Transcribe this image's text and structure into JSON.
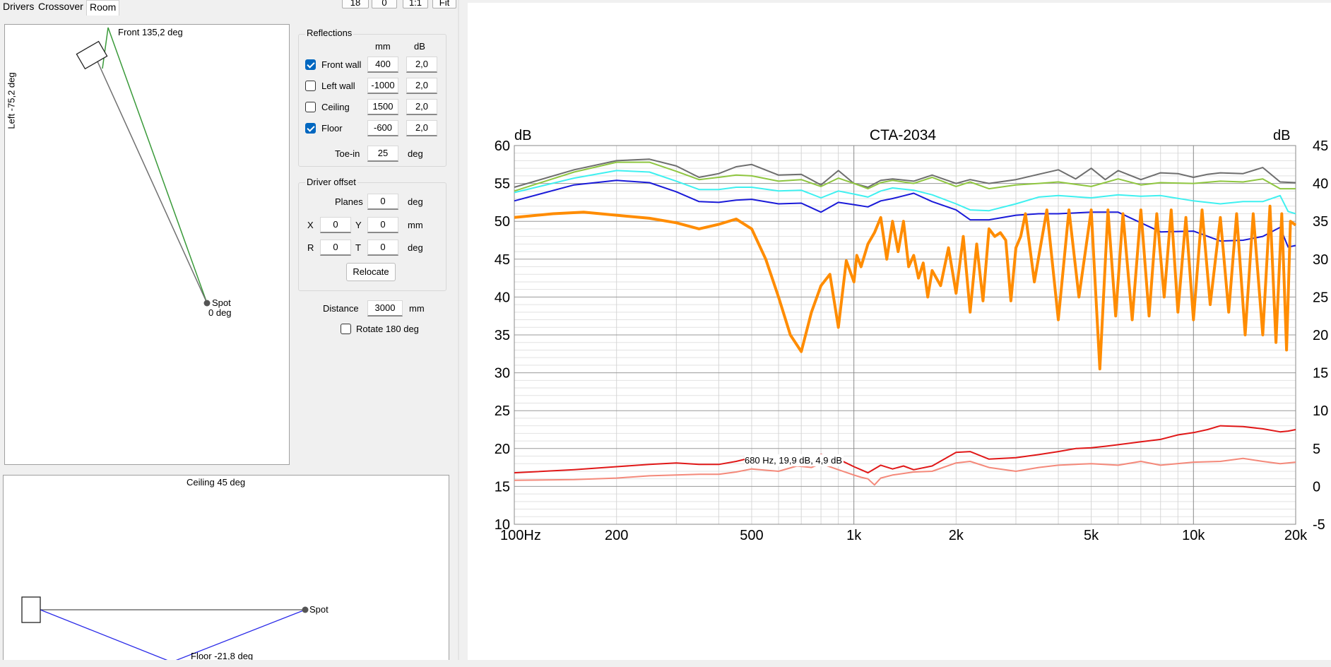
{
  "tabs": [
    {
      "label": "Drivers",
      "active": false
    },
    {
      "label": "Crossover",
      "active": false
    },
    {
      "label": "Room",
      "active": true
    }
  ],
  "toolbar": {
    "b1": "18",
    "b2": "0",
    "b3": "1:1",
    "b4": "Fit"
  },
  "top_view": {
    "front_label": "Front 135,2 deg",
    "left_label": "Left -75,2 deg",
    "spot_label": "Spot",
    "spot_deg": "0 deg"
  },
  "side_view": {
    "ceiling_label": "Ceiling 45 deg",
    "floor_label": "Floor -21,8 deg",
    "spot_label": "Spot"
  },
  "reflections": {
    "title": "Reflections",
    "col_mm": "mm",
    "col_db": "dB",
    "rows": [
      {
        "label": "Front wall",
        "checked": true,
        "mm": "400",
        "db": "2,0"
      },
      {
        "label": "Left wall",
        "checked": false,
        "mm": "-1000",
        "db": "2,0"
      },
      {
        "label": "Ceiling",
        "checked": false,
        "mm": "1500",
        "db": "2,0"
      },
      {
        "label": "Floor",
        "checked": true,
        "mm": "-600",
        "db": "2,0"
      }
    ],
    "toein_label": "Toe-in",
    "toein_value": "25",
    "toein_unit": "deg"
  },
  "driver_offset": {
    "title": "Driver offset",
    "planes_label": "Planes",
    "planes_value": "0",
    "planes_unit": "deg",
    "x_label": "X",
    "x_value": "0",
    "y_label": "Y",
    "y_value": "0",
    "xy_unit": "mm",
    "r_label": "R",
    "r_value": "0",
    "t_label": "T",
    "t_value": "0",
    "rt_unit": "deg",
    "relocate_label": "Relocate"
  },
  "distance": {
    "label": "Distance",
    "value": "3000",
    "unit": "mm"
  },
  "rotate": {
    "label": "Rotate 180 deg",
    "checked": false
  },
  "chart_data": {
    "type": "line",
    "title": "CTA-2034",
    "ylabel_left": "dB",
    "ylabel_right": "dB",
    "x_scale": "log",
    "xlim": [
      100,
      20000
    ],
    "ylim": [
      10,
      60
    ],
    "ylim_right": [
      -5,
      45
    ],
    "x_ticks": [
      {
        "value": 100,
        "label": "100Hz"
      },
      {
        "value": 200,
        "label": "200"
      },
      {
        "value": 500,
        "label": "500"
      },
      {
        "value": 1000,
        "label": "1k"
      },
      {
        "value": 2000,
        "label": "2k"
      },
      {
        "value": 5000,
        "label": "5k"
      },
      {
        "value": 10000,
        "label": "10k"
      },
      {
        "value": 20000,
        "label": "20k"
      }
    ],
    "y_ticks_left": [
      "10",
      "15",
      "20",
      "25",
      "30",
      "35",
      "40",
      "45",
      "50",
      "55",
      "60"
    ],
    "y_ticks_right": [
      "-5",
      "0",
      "5",
      "10",
      "15",
      "20",
      "25",
      "30",
      "35",
      "40",
      "45"
    ],
    "annotation": "680 Hz, 19,9 dB, 4,9 dB",
    "grid": true,
    "colors": {
      "gray": "#6e6e6e",
      "green": "#8fc640",
      "cyan": "#3ff0f0",
      "blue": "#1a1ad8",
      "orange": "#ff8c00",
      "red": "#e01818",
      "pink": "#f4897a"
    },
    "series": [
      {
        "key": "gray",
        "width": 2,
        "x": [
          100,
          150,
          200,
          250,
          300,
          350,
          400,
          450,
          500,
          600,
          700,
          800,
          900,
          1000,
          1100,
          1200,
          1300,
          1500,
          1700,
          2000,
          2200,
          2500,
          3000,
          3500,
          4000,
          4500,
          5000,
          5500,
          6000,
          7000,
          8000,
          9000,
          10000,
          11000,
          12000,
          14000,
          16000,
          18000,
          20000
        ],
        "y": [
          54.5,
          56.8,
          58.0,
          58.2,
          57.3,
          55.8,
          56.3,
          57.2,
          57.5,
          56.1,
          56.2,
          54.8,
          56.7,
          55.0,
          54.5,
          55.4,
          55.6,
          55.3,
          56.1,
          55.0,
          55.5,
          55.0,
          55.5,
          56.2,
          56.8,
          55.6,
          57.0,
          55.5,
          56.7,
          55.5,
          56.4,
          56.3,
          55.8,
          56.2,
          56.4,
          56.3,
          57.1,
          55.2,
          55.1
        ]
      },
      {
        "key": "green",
        "width": 2,
        "x": [
          100,
          150,
          200,
          250,
          300,
          350,
          400,
          450,
          500,
          600,
          700,
          800,
          900,
          1000,
          1100,
          1200,
          1300,
          1500,
          1700,
          2000,
          2200,
          2500,
          3000,
          3500,
          4000,
          5000,
          6000,
          7000,
          8000,
          10000,
          12000,
          14000,
          16000,
          18000,
          20000
        ],
        "y": [
          54.0,
          56.5,
          57.8,
          57.8,
          56.6,
          55.5,
          55.8,
          56.1,
          56.0,
          55.3,
          55.5,
          54.6,
          55.7,
          55.0,
          54.3,
          55.1,
          55.4,
          55.0,
          55.8,
          54.6,
          55.2,
          54.3,
          54.8,
          55.0,
          55.2,
          54.6,
          55.6,
          54.8,
          55.1,
          55.0,
          55.3,
          55.2,
          55.6,
          54.3,
          54.3
        ]
      },
      {
        "key": "cyan",
        "width": 2,
        "x": [
          100,
          150,
          200,
          250,
          300,
          350,
          400,
          450,
          500,
          600,
          700,
          800,
          900,
          1000,
          1100,
          1200,
          1300,
          1500,
          1700,
          2000,
          2200,
          2500,
          3000,
          3500,
          4000,
          5000,
          6000,
          7000,
          8000,
          10000,
          12000,
          14000,
          16000,
          18000,
          19000,
          20000
        ],
        "y": [
          53.8,
          55.7,
          56.7,
          56.5,
          55.3,
          54.2,
          54.2,
          54.5,
          54.5,
          54.0,
          54.1,
          53.1,
          54.0,
          53.6,
          53.2,
          54.0,
          54.4,
          54.1,
          53.5,
          52.3,
          51.5,
          51.4,
          52.3,
          53.2,
          53.4,
          53.1,
          53.5,
          53.3,
          53.4,
          52.7,
          52.3,
          52.6,
          52.6,
          53.4,
          51.3,
          51.0
        ]
      },
      {
        "key": "blue",
        "width": 2,
        "x": [
          100,
          150,
          200,
          250,
          300,
          350,
          400,
          450,
          500,
          600,
          700,
          800,
          900,
          1000,
          1100,
          1200,
          1300,
          1500,
          1700,
          2000,
          2200,
          2500,
          3000,
          3500,
          4000,
          5000,
          6000,
          7000,
          8000,
          10000,
          12000,
          14000,
          16000,
          18000,
          19000,
          20000
        ],
        "y": [
          52.7,
          54.8,
          55.4,
          55.1,
          53.9,
          52.6,
          52.5,
          52.8,
          52.9,
          52.3,
          52.4,
          51.2,
          52.5,
          52.2,
          51.9,
          52.7,
          53.0,
          53.7,
          52.6,
          51.5,
          50.2,
          50.2,
          50.8,
          51.0,
          51.0,
          51.2,
          51.2,
          49.8,
          48.6,
          48.7,
          47.4,
          47.5,
          48.0,
          49.2,
          46.6,
          46.8
        ]
      },
      {
        "key": "orange",
        "width": 4,
        "x": [
          100,
          130,
          160,
          200,
          250,
          300,
          350,
          400,
          450,
          500,
          550,
          600,
          650,
          700,
          750,
          800,
          850,
          900,
          950,
          1000,
          1020,
          1050,
          1100,
          1150,
          1200,
          1250,
          1300,
          1350,
          1400,
          1450,
          1500,
          1550,
          1600,
          1650,
          1700,
          1800,
          1900,
          2000,
          2100,
          2200,
          2300,
          2400,
          2500,
          2600,
          2700,
          2800,
          2900,
          3000,
          3100,
          3200,
          3400,
          3700,
          4000,
          4300,
          4600,
          5000,
          5300,
          5600,
          5900,
          6200,
          6600,
          7000,
          7400,
          7800,
          8200,
          8600,
          9000,
          9500,
          10000,
          10600,
          11200,
          12000,
          12700,
          13400,
          14200,
          15000,
          16000,
          16800,
          17500,
          18200,
          18800,
          19300,
          20000
        ],
        "y": [
          50.5,
          51.0,
          51.2,
          50.8,
          50.4,
          49.8,
          49.0,
          49.6,
          50.3,
          49.0,
          45.0,
          40.0,
          35.0,
          32.8,
          38.0,
          41.5,
          43.0,
          36.0,
          44.8,
          42.0,
          45.5,
          44.0,
          47.0,
          48.5,
          50.5,
          45.0,
          50.0,
          46.0,
          50.0,
          44.0,
          45.5,
          42.5,
          44.5,
          40.0,
          43.5,
          41.5,
          46.5,
          40.5,
          48.0,
          38.0,
          47.0,
          39.5,
          49.0,
          48.0,
          48.5,
          47.5,
          39.5,
          46.5,
          48.0,
          51.0,
          42.0,
          51.5,
          37.0,
          51.5,
          40.0,
          51.5,
          30.5,
          51.5,
          37.5,
          51.0,
          37.0,
          51.5,
          37.5,
          51.0,
          40.0,
          51.5,
          38.0,
          50.5,
          37.0,
          51.5,
          39.0,
          50.5,
          38.0,
          51.0,
          35.0,
          51.0,
          35.0,
          52.0,
          34.0,
          51.0,
          33.0,
          50.0,
          49.5
        ]
      },
      {
        "key": "red",
        "width": 2,
        "x": [
          100,
          150,
          200,
          250,
          300,
          350,
          400,
          450,
          500,
          600,
          680,
          750,
          800,
          900,
          1000,
          1050,
          1100,
          1200,
          1300,
          1400,
          1500,
          1700,
          2000,
          2200,
          2500,
          3000,
          3500,
          4000,
          4500,
          5000,
          5500,
          6000,
          7000,
          8000,
          9000,
          10000,
          11000,
          12000,
          14000,
          16000,
          18000,
          19000,
          20000
        ],
        "y": [
          16.8,
          17.2,
          17.6,
          17.9,
          18.1,
          17.9,
          17.9,
          18.3,
          18.8,
          18.1,
          19.1,
          18.4,
          19.2,
          18.6,
          17.6,
          17.2,
          16.8,
          17.8,
          17.3,
          17.7,
          17.2,
          17.7,
          19.5,
          19.6,
          18.6,
          18.8,
          19.2,
          19.6,
          20.0,
          20.1,
          20.3,
          20.5,
          20.9,
          21.2,
          21.8,
          22.1,
          22.5,
          23.0,
          22.9,
          22.6,
          22.2,
          22.3,
          22.5
        ]
      },
      {
        "key": "pink",
        "width": 2,
        "x": [
          100,
          150,
          200,
          250,
          300,
          350,
          400,
          450,
          500,
          600,
          680,
          750,
          800,
          900,
          1000,
          1050,
          1100,
          1150,
          1200,
          1300,
          1500,
          1700,
          2000,
          2200,
          2500,
          3000,
          3500,
          4000,
          5000,
          6000,
          7000,
          8000,
          10000,
          12000,
          14000,
          16000,
          18000,
          20000
        ],
        "y": [
          15.8,
          15.9,
          16.1,
          16.4,
          16.5,
          16.6,
          16.6,
          16.9,
          17.3,
          17.0,
          17.7,
          17.5,
          18.0,
          17.2,
          16.5,
          16.2,
          16.0,
          15.2,
          16.1,
          16.5,
          16.9,
          17.0,
          18.1,
          18.3,
          17.5,
          17.0,
          17.5,
          17.8,
          18.0,
          17.8,
          18.3,
          17.8,
          18.2,
          18.3,
          18.7,
          18.3,
          18.0,
          18.2
        ]
      }
    ]
  }
}
